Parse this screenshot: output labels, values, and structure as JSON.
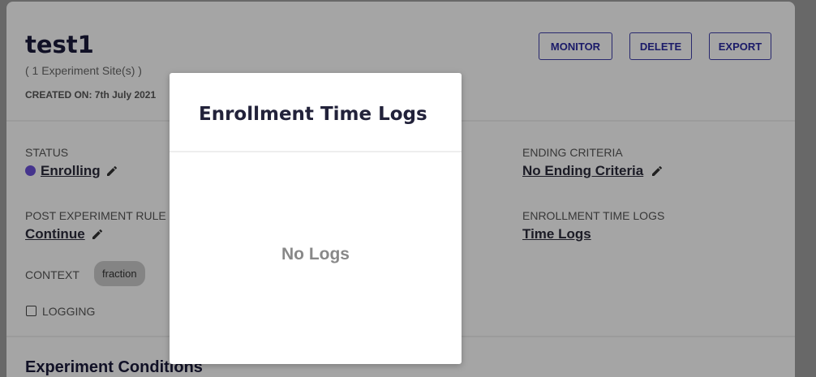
{
  "experiment": {
    "title": "test1",
    "sites": "( 1 Experiment Site(s) )",
    "created_on": "CREATED ON: 7th July 2021"
  },
  "header_buttons": {
    "monitor": "MONITOR",
    "delete": "DELETE",
    "export": "EXPORT"
  },
  "details": {
    "status_label": "STATUS",
    "status_value": "Enrolling",
    "status_color": "#6a4fd6",
    "ending_label": "ENDING CRITERIA",
    "ending_value": "No Ending Criteria",
    "post_rule_label": "POST EXPERIMENT RULE",
    "post_rule_value": "Continue",
    "time_logs_label": "ENROLLMENT TIME LOGS",
    "time_logs_value": "Time Logs",
    "context_label": "CONTEXT",
    "context_chip": "fraction",
    "logging_label": "LOGGING"
  },
  "section": {
    "conditions_title": "Experiment Conditions"
  },
  "modal": {
    "title": "Enrollment Time Logs",
    "empty_message": "No Logs"
  },
  "icons": {
    "edit": "pencil-icon",
    "checkbox": "checkbox-unchecked"
  }
}
